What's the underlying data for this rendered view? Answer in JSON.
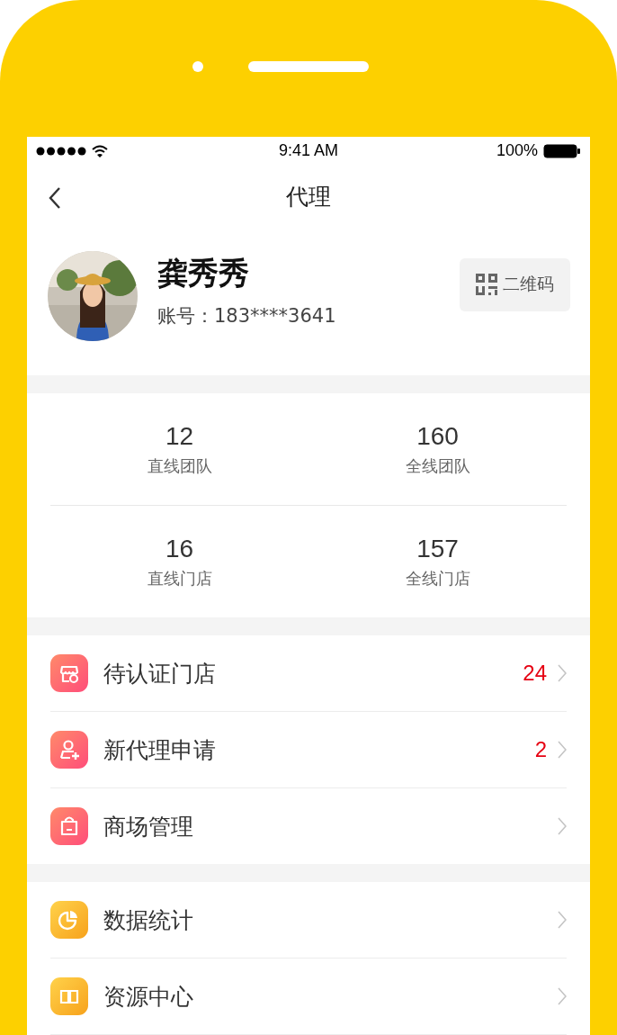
{
  "status_bar": {
    "time": "9:41 AM",
    "battery": "100%"
  },
  "nav": {
    "title": "代理"
  },
  "profile": {
    "name": "龚秀秀",
    "account": "账号：183****3641",
    "qr_button": "二维码"
  },
  "stats": [
    {
      "value": "12",
      "label": "直线团队"
    },
    {
      "value": "160",
      "label": "全线团队"
    },
    {
      "value": "16",
      "label": "直线门店"
    },
    {
      "value": "157",
      "label": "全线门店"
    }
  ],
  "menu_groups": [
    {
      "items": [
        {
          "kind": "store",
          "label": "待认证门店",
          "count": "24"
        },
        {
          "kind": "person-add",
          "label": "新代理申请",
          "count": "2"
        },
        {
          "kind": "bag",
          "label": "商场管理"
        }
      ]
    },
    {
      "items": [
        {
          "kind": "chart",
          "label": "数据统计"
        },
        {
          "kind": "book",
          "label": "资源中心"
        }
      ]
    }
  ]
}
